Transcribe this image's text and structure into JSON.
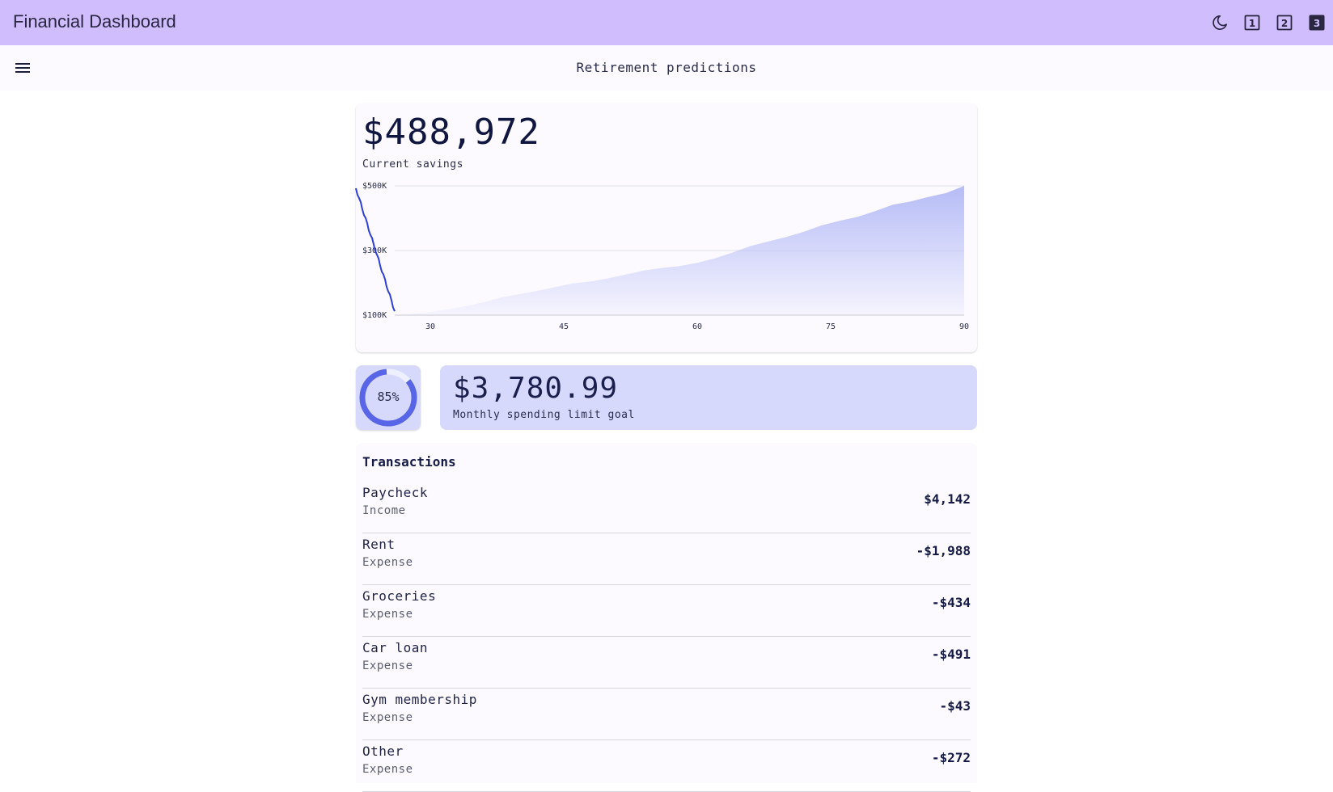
{
  "app": {
    "title": "Financial Dashboard",
    "actions": [
      {
        "name": "dark-mode-icon"
      },
      {
        "name": "layout-1-icon",
        "label": "1"
      },
      {
        "name": "layout-2-icon",
        "label": "2"
      },
      {
        "name": "layout-3-icon",
        "label": "3"
      }
    ]
  },
  "subheader": {
    "title": "Retirement predictions"
  },
  "savings": {
    "value": "$488,972",
    "label": "Current savings"
  },
  "chart_data": {
    "type": "area",
    "x": [
      26,
      28,
      30,
      32,
      34,
      36,
      38,
      40,
      42,
      44,
      46,
      48,
      50,
      52,
      54,
      56,
      58,
      60,
      62,
      64,
      66,
      68,
      70,
      72,
      74,
      76,
      78,
      80,
      82,
      84,
      86,
      88,
      90
    ],
    "series": [
      {
        "values": [
          100000,
          105000,
          110000,
          118000,
          128000,
          140000,
          155000,
          165000,
          175000,
          187000,
          198000,
          204000,
          214000,
          226000,
          238000,
          246000,
          252000,
          262000,
          276000,
          294000,
          314000,
          328000,
          342000,
          358000,
          378000,
          392000,
          404000,
          422000,
          442000,
          452000,
          466000,
          478000,
          500000
        ]
      }
    ],
    "ylabels": [
      "$500K",
      "$300K",
      "$100K"
    ],
    "yticks": [
      500000,
      300000,
      100000
    ],
    "xticks": [
      30,
      45,
      60,
      75,
      90
    ],
    "xlim": [
      26,
      90
    ],
    "ylim": [
      100000,
      500000
    ],
    "grid": true,
    "colors": {
      "fill": "#b6bcf6",
      "line": "#2e3fd6"
    }
  },
  "goal": {
    "percent_label": "85%",
    "percent": 85,
    "value": "$3,780.99",
    "label": "Monthly spending limit goal",
    "colors": {
      "ring": "#5865e6",
      "track": "#eef0ff"
    }
  },
  "transactions": {
    "title": "Transactions",
    "items": [
      {
        "name": "Paycheck",
        "type": "Income",
        "amount": "$4,142"
      },
      {
        "name": "Rent",
        "type": "Expense",
        "amount": "-$1,988"
      },
      {
        "name": "Groceries",
        "type": "Expense",
        "amount": "-$434"
      },
      {
        "name": "Car loan",
        "type": "Expense",
        "amount": "-$491"
      },
      {
        "name": "Gym membership",
        "type": "Expense",
        "amount": "-$43"
      },
      {
        "name": "Other",
        "type": "Expense",
        "amount": "-$272"
      }
    ]
  }
}
